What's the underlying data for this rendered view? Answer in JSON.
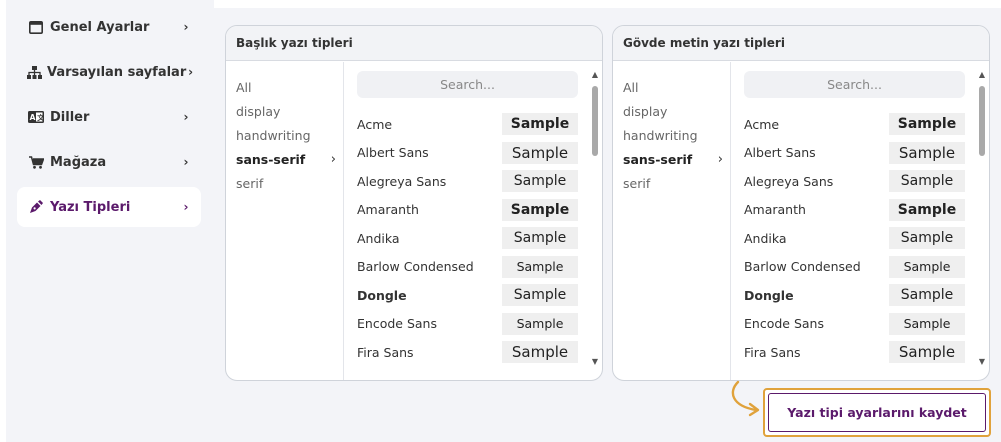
{
  "sidebar": {
    "items": [
      {
        "label": "Genel Ayarlar",
        "icon": "window-icon",
        "chevron": "›"
      },
      {
        "label": "Varsayılan sayfalar",
        "icon": "sitemap-icon",
        "chevron": "›"
      },
      {
        "label": "Diller",
        "icon": "language-icon",
        "chevron": "›"
      },
      {
        "label": "Mağaza",
        "icon": "cart-icon",
        "chevron": "›"
      },
      {
        "label": "Yazı Tipleri",
        "icon": "pen-icon",
        "chevron": "›",
        "active": true
      }
    ]
  },
  "panels": [
    {
      "title": "Başlık yazı tipleri",
      "categories": [
        "All",
        "display",
        "handwriting",
        "sans-serif",
        "serif"
      ],
      "selected_category": "sans-serif",
      "search_placeholder": "Search...",
      "fonts": [
        {
          "name": "Acme",
          "sample": "Sample"
        },
        {
          "name": "Albert Sans",
          "sample": "Sample"
        },
        {
          "name": "Alegreya Sans",
          "sample": "Sample"
        },
        {
          "name": "Amaranth",
          "sample": "Sample"
        },
        {
          "name": "Andika",
          "sample": "Sample"
        },
        {
          "name": "Barlow Condensed",
          "sample": "Sample"
        },
        {
          "name": "Dongle",
          "sample": "Sample",
          "selected": true
        },
        {
          "name": "Encode Sans",
          "sample": "Sample"
        },
        {
          "name": "Fira Sans",
          "sample": "Sample"
        }
      ]
    },
    {
      "title": "Gövde metin yazı tipleri",
      "categories": [
        "All",
        "display",
        "handwriting",
        "sans-serif",
        "serif"
      ],
      "selected_category": "sans-serif",
      "search_placeholder": "Search...",
      "fonts": [
        {
          "name": "Acme",
          "sample": "Sample"
        },
        {
          "name": "Albert Sans",
          "sample": "Sample"
        },
        {
          "name": "Alegreya Sans",
          "sample": "Sample"
        },
        {
          "name": "Amaranth",
          "sample": "Sample"
        },
        {
          "name": "Andika",
          "sample": "Sample"
        },
        {
          "name": "Barlow Condensed",
          "sample": "Sample"
        },
        {
          "name": "Dongle",
          "sample": "Sample",
          "selected": true
        },
        {
          "name": "Encode Sans",
          "sample": "Sample"
        },
        {
          "name": "Fira Sans",
          "sample": "Sample"
        }
      ]
    }
  ],
  "save_button": {
    "label": "Yazı tipi ayarlarını kaydet"
  },
  "colors": {
    "accent": "#5b1a6b",
    "highlight": "#e0a23b",
    "background": "#f3f4f8"
  }
}
